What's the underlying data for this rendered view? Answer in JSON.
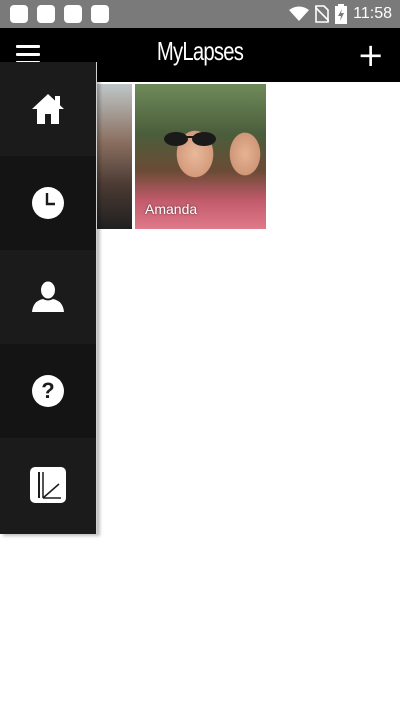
{
  "status_bar": {
    "time": "11:58",
    "left_icons": [
      "notification-icon",
      "notification-icon",
      "notification-icon",
      "notification-icon"
    ],
    "right_icons": [
      "wifi-icon",
      "no-sim-icon",
      "battery-charging-icon"
    ]
  },
  "app_bar": {
    "title": "MyLapses",
    "menu_icon": "hamburger-menu-icon",
    "add_icon": "plus-icon"
  },
  "photos": [
    {
      "name": ""
    },
    {
      "name": "Amanda"
    }
  ],
  "drawer": {
    "items": [
      {
        "icon": "home-icon"
      },
      {
        "icon": "clock-icon"
      },
      {
        "icon": "profile-icon"
      },
      {
        "icon": "help-icon"
      },
      {
        "icon": "app-logo-icon"
      }
    ]
  },
  "colors": {
    "status_bar": "#7a7a7a",
    "app_bar": "#000000",
    "drawer": "#1b1b1b",
    "background": "#ffffff"
  }
}
